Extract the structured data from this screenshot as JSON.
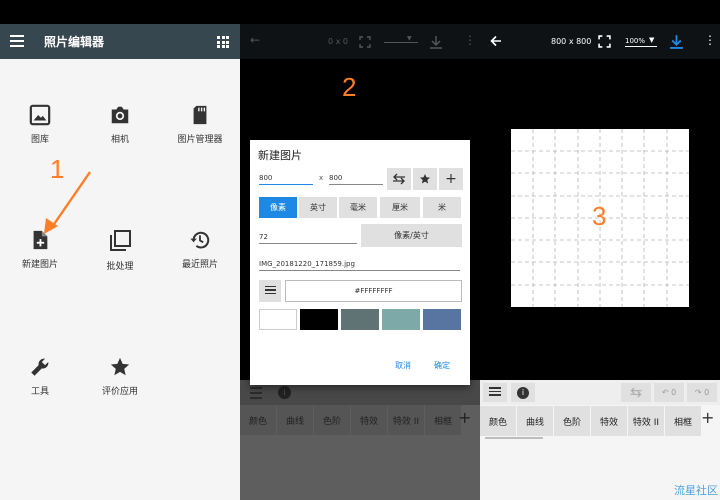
{
  "panel1": {
    "app_title": "照片编辑器",
    "tiles": [
      {
        "label": "图库",
        "icon": "image-icon"
      },
      {
        "label": "相机",
        "icon": "camera-icon"
      },
      {
        "label": "图片管理器",
        "icon": "sd-card-icon"
      },
      {
        "label": "新建图片",
        "icon": "new-file-icon"
      },
      {
        "label": "批处理",
        "icon": "batch-icon"
      },
      {
        "label": "最近照片",
        "icon": "history-icon"
      },
      {
        "label": "工具",
        "icon": "wrench-icon"
      },
      {
        "label": "评价应用",
        "icon": "star-icon"
      }
    ],
    "callout": "1"
  },
  "panel2": {
    "top_dims": "0 x 0",
    "callout": "2",
    "dialog": {
      "title": "新建图片",
      "width_value": "800",
      "times": "x",
      "height_value": "800",
      "units": [
        "像素",
        "英寸",
        "毫米",
        "厘米",
        "米"
      ],
      "dpi_value": "72",
      "dpi_button": "像素/英寸",
      "filename": "IMG_20181220_171859.jpg",
      "color_value": "#FFFFFFFF",
      "swatches": [
        "#ffffff",
        "#000000",
        "#5f7374",
        "#7ea9a9",
        "#5874a0"
      ],
      "cancel": "取消",
      "ok": "确定"
    },
    "tabs": [
      "颜色",
      "曲线",
      "色阶",
      "特效",
      "特效 II",
      "相框"
    ]
  },
  "panel3": {
    "dims": "800 x 800",
    "zoom": "100%",
    "callout": "3",
    "undo_count": "0",
    "redo_count": "0",
    "tabs": [
      "颜色",
      "曲线",
      "色阶",
      "特效",
      "特效 II",
      "相框"
    ],
    "watermark": "流星社区"
  },
  "colors": {
    "accent": "#1e88e5",
    "callout": "#ff7d27",
    "toolbar": "#37474f"
  }
}
